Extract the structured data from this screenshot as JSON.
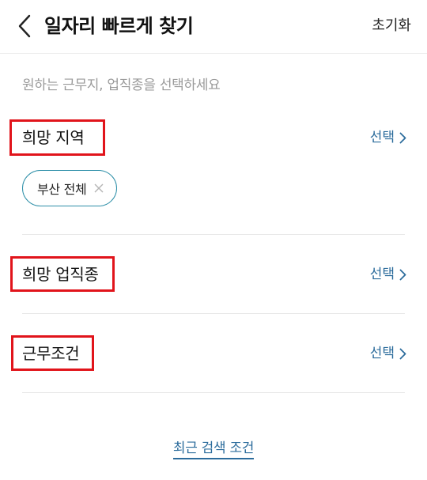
{
  "header": {
    "title": "일자리 빠르게 찾기",
    "reset_label": "초기화",
    "back_icon": "chevron-left-icon"
  },
  "instruction": "원하는 근무지, 업직종을 선택하세요",
  "sections": {
    "region": {
      "title": "희망 지역",
      "select_label": "선택",
      "selected_chips": [
        {
          "label": "부산 전체"
        }
      ]
    },
    "job_type": {
      "title": "희망 업직종",
      "select_label": "선택"
    },
    "conditions": {
      "title": "근무조건",
      "select_label": "선택"
    }
  },
  "recent_search_link": "최근 검색 조건",
  "colors": {
    "accent": "#2c6c9c",
    "chip_border": "#2d8fa8",
    "highlight": "#e1141b",
    "muted_text": "#9a9a9a"
  }
}
